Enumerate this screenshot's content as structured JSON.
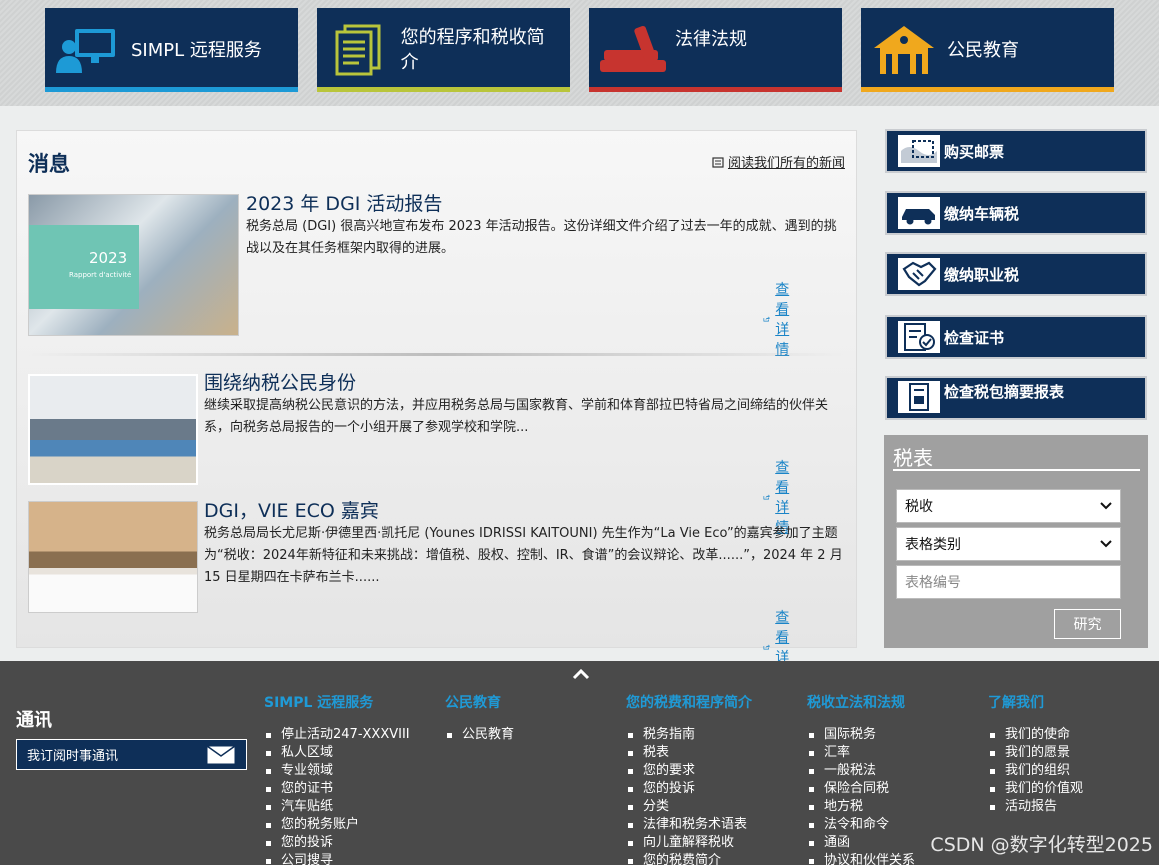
{
  "tiles": [
    {
      "label": "SIMPL 远程服务",
      "icon": "computer-user-icon",
      "bar_color": "#1d9ad6"
    },
    {
      "label": "您的程序和税收简介",
      "icon": "documents-icon",
      "bar_color": "#b9c53b"
    },
    {
      "label": "法律法规",
      "icon": "law-books-icon",
      "bar_color": "#c7342f"
    },
    {
      "label": "公民教育",
      "icon": "school-building-icon",
      "bar_color": "#f0a81d"
    }
  ],
  "news": {
    "title": "消息",
    "read_all": "阅读我们所有的新闻",
    "more_label": "查看详情",
    "articles": [
      {
        "title": "2023 年 DGI 活动报告",
        "text": "税务总局 (DGI) 很高兴地宣布发布 2023 年活动报告。这份详细文件介绍了过去一年的成就、遇到的挑战以及在其任务框架内取得的进展。",
        "thumb_year": "2023",
        "thumb_caption": "Rapport d'activité"
      },
      {
        "title": "围绕纳税公民身份",
        "text": "继续采取提高纳税公民意识的方法，并应用税务总局与国家教育、学前和体育部拉巴特省局之间缔结的伙伴关系，向税务总局报告的一个小组开展了参观学校和学院..."
      },
      {
        "title": "DGI，VIE ECO 嘉宾",
        "text": "税务总局局长尤尼斯·伊德里西·凯托尼 (Younes IDRISSI KAITOUNI) 先生作为“La Vie Eco”的嘉宾参加了主题为“税收：2024年新特征和未来挑战：增值税、股权、控制、IR、食谱”的会议辩论、改革......”，2024 年 2 月 15 日星期四在卡萨布兰卡......"
      }
    ]
  },
  "services": [
    {
      "label": "购买邮票",
      "icon": "stamp-icon"
    },
    {
      "label": "缴纳车辆税",
      "icon": "car-icon"
    },
    {
      "label": "缴纳职业税",
      "icon": "handshake-icon"
    },
    {
      "label": "检查证书",
      "icon": "certificate-check-icon"
    },
    {
      "label": "检查税包摘要报表",
      "icon": "report-icon"
    }
  ],
  "tax_forms": {
    "title": "税表",
    "select1": "税收",
    "select2": "表格类别",
    "number_placeholder": "表格编号",
    "search_label": "研究"
  },
  "footer": {
    "newsletter_title": "通讯",
    "newsletter_button": "我订阅时事通讯",
    "columns": [
      {
        "title": "SIMPL 远程服务",
        "items": [
          "停止活动247-XXXVIII",
          "私人区域",
          "专业领域",
          "您的证书",
          "汽车贴纸",
          "您的税务账户",
          "您的投诉",
          "公司搜寻"
        ]
      },
      {
        "title": "公民教育",
        "items": [
          "公民教育"
        ]
      },
      {
        "title": "您的税费和程序简介",
        "items": [
          "税务指南",
          "税表",
          "您的要求",
          "您的投诉",
          "分类",
          "法律和税务术语表",
          "向儿童解释税收",
          "您的税费简介"
        ]
      },
      {
        "title": "税收立法和法规",
        "items": [
          "国际税务",
          "汇率",
          "一般税法",
          "保险合同税",
          "地方税",
          "法令和命令",
          "通函",
          "协议和伙伴关系"
        ]
      },
      {
        "title": "了解我们",
        "items": [
          "我们的使命",
          "我们的愿景",
          "我们的组织",
          "我们的价值观",
          "活动报告"
        ]
      }
    ],
    "watermark": "CSDN @数字化转型2025"
  }
}
